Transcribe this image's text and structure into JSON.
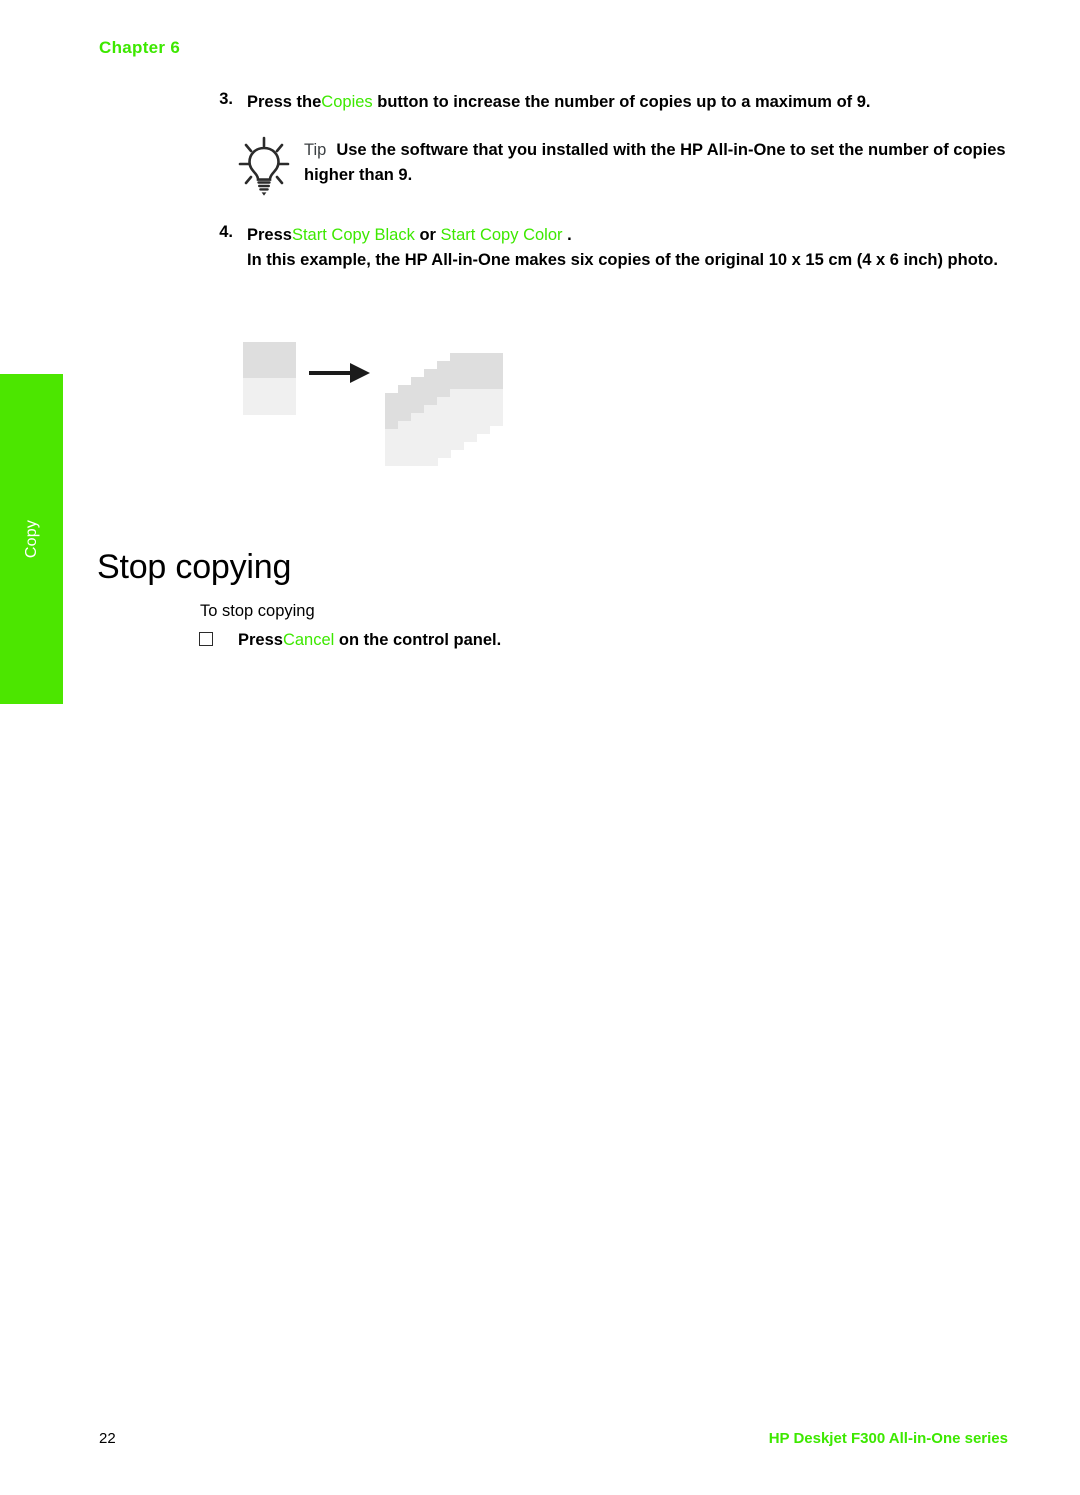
{
  "page": {
    "chapter_header": "Chapter 6",
    "page_number": "22",
    "product_footer": "HP Deskjet F300 All-in-One series",
    "accent_green": "#3DE800",
    "tab_green": "#4CE600"
  },
  "side_tab": {
    "label": "Copy"
  },
  "steps": [
    {
      "number": "3.",
      "text_before": "Press the",
      "ui_control": "Copies",
      "text_after": " button to increase the number of copies up to a maximum of 9."
    },
    {
      "number": "4.",
      "text_before": "Press",
      "ui_control_1": "Start Copy Black",
      "conjunction": " or ",
      "ui_control_2": "Start Copy Color",
      "text_after": " .",
      "detail": "In this example, the HP All-in-One makes six copies of the original 10 x 15 cm (4 x 6 inch) photo."
    }
  ],
  "tip": {
    "icon": "lightbulb-icon",
    "label": "Tip",
    "text": "Use the software that you installed with the HP All-in-One to set the number of copies higher than 9."
  },
  "illustration": {
    "name": "copy-example-diagram",
    "source_label": "original-photo",
    "arrow_label": "right-arrow",
    "copies_count": 6,
    "photo_top_color": "#dedede",
    "photo_bottom_color": "#f0f0f0"
  },
  "section": {
    "heading": "Stop copying",
    "procedure_title": "To stop copying",
    "bullet": {
      "text_before": "Press",
      "ui_control": "Cancel",
      "text_after": " on the control panel."
    }
  }
}
